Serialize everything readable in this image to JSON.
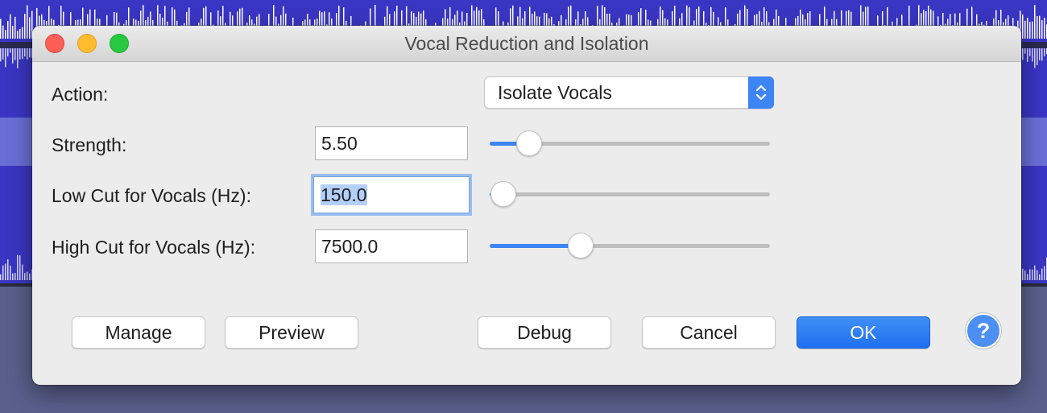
{
  "window": {
    "title": "Vocal Reduction and Isolation"
  },
  "action": {
    "label": "Action:",
    "selected": "Isolate Vocals"
  },
  "strength": {
    "label": "Strength:",
    "value": "5.50",
    "slider_fraction": 0.14
  },
  "low_cut": {
    "label": "Low Cut for Vocals (Hz):",
    "value": "150.0",
    "slider_fraction": 0.05
  },
  "high_cut": {
    "label": "High Cut for Vocals (Hz):",
    "value": "7500.0",
    "slider_fraction": 0.325
  },
  "buttons": {
    "manage": "Manage",
    "preview": "Preview",
    "debug": "Debug",
    "cancel": "Cancel",
    "ok": "OK",
    "help": "?"
  },
  "colors": {
    "accent": "#3d84f5",
    "waveform": "#3a36c4",
    "waveform_light": "#6a6fd6"
  }
}
